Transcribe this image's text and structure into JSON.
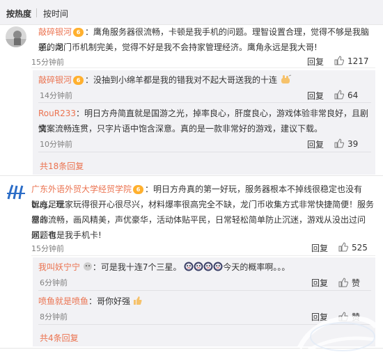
{
  "sort": {
    "hot": "按热度",
    "time": "按时间"
  },
  "c1": {
    "user": "敲碎银河",
    "vip": "6",
    "line1": "：鹰角服务器很流畅，卡顿是我手机的问题。理智设置合理，觉得不够是我脑子的问",
    "line2": "题。龙门币机制完美，觉得不好是我不会持家管理经济。鹰角永远是我大哥!",
    "time": "15分钟前",
    "reply": "回复",
    "likes": "1217",
    "replies": [
      {
        "user": "敲碎银河",
        "vip": "6",
        "text": "：没抽到小绵羊都是我的错我对不起大哥送我的十连",
        "emoji": "hand-icon",
        "time": "14分钟前",
        "reply": "回复",
        "likes": "64"
      },
      {
        "user": "RouR233",
        "line1": "：明日方舟简直就是国游之光，掉率良心，肝度良心，游戏体验非常良好，且剧情",
        "line2": "文案流畅连贯，只字片语中饱含深意。真的是一款非常好的游戏，建议下载。",
        "time": "10分钟前",
        "reply": "回复",
        "likes": "39"
      }
    ],
    "more": "共18条回复"
  },
  "c2": {
    "user": "广东外语外贸大学经贸学院",
    "vip": "6",
    "line1": "：明日方舟真的第一好玩，服务器根本不掉线很稳定也没有bug，理",
    "line2": "智充足玩家玩得很开心很尽兴，材料爆率很高完全不缺，龙门币收集方式非常快捷简便！服务器非",
    "line3": "常的流畅，画风精美，声优豪华，活动体贴平民，日常轻松简单防止沉迷，游戏从没出过问题，有",
    "line4": "问题也是我手机卡!",
    "time": "15分钟前",
    "reply": "回复",
    "likes": "525",
    "replies": [
      {
        "user": "我叫妖宁宁",
        "text_a": "：可是我十连7个三星。",
        "text_b": "今天的概率啊。。。",
        "time": "6分钟前",
        "reply": "回复",
        "likes": "赞"
      },
      {
        "user": "喷鱼就是喷鱼",
        "text": "：哥你好强",
        "time": "8分钟前",
        "reply": "回复",
        "likes": "赞"
      }
    ],
    "more": "共4条回复"
  },
  "colors": {
    "username": "#eb7350",
    "reply_bg": "#f2f2f5",
    "text": "#333333",
    "muted": "#808080"
  }
}
